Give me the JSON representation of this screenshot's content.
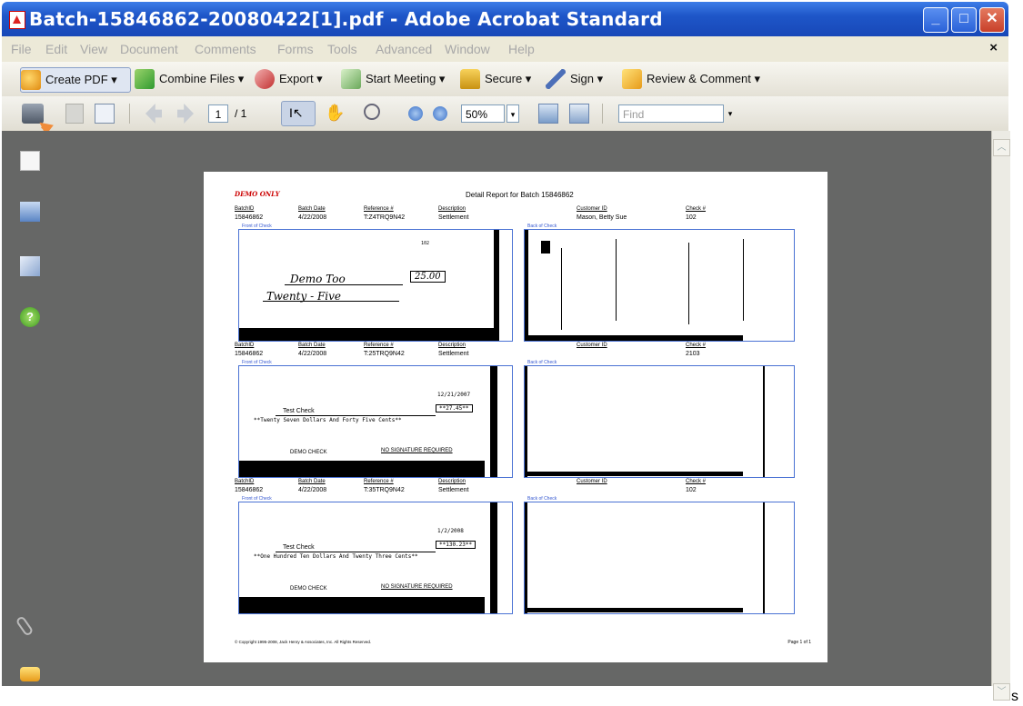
{
  "window": {
    "title": "Batch-15846862-20080422[1].pdf - Adobe Acrobat Standard",
    "minimize": "_",
    "maximize": "□",
    "close": "✕"
  },
  "menu": [
    "File",
    "Edit",
    "View",
    "Document",
    "Comments",
    "Forms",
    "Tools",
    "Advanced",
    "Window",
    "Help"
  ],
  "menu_close": "×",
  "toolbar": {
    "create_pdf": "Create PDF ▾",
    "combine": "Combine Files ▾",
    "export": "Export ▾",
    "meeting": "Start Meeting ▾",
    "secure": "Secure ▾",
    "sign": "Sign ▾",
    "review": "Review & Comment ▾"
  },
  "nav": {
    "page": "1",
    "of": "/ 1",
    "zoom": "50%",
    "find_placeholder": "Find"
  },
  "colors": {
    "titlebar": "#1e56c8",
    "accent_arrow": "#f08c3a",
    "workspace": "#666766"
  },
  "report": {
    "demo": "DEMO ONLY",
    "title": "Detail Report for Batch 15846862",
    "headers": [
      "BatchID",
      "Batch Date",
      "Reference #",
      "Description",
      "Customer ID",
      "Check #"
    ],
    "rows": [
      {
        "batch": "15846862",
        "date": "4/22/2008",
        "ref": "T:Z4TRQ9N42",
        "desc": "Settlement",
        "cust": "Mason, Betty Sue",
        "check": "102"
      },
      {
        "batch": "15846862",
        "date": "4/22/2008",
        "ref": "T:25TRQ9N42",
        "desc": "Settlement",
        "cust": "",
        "check": "2103"
      },
      {
        "batch": "15846862",
        "date": "4/22/2008",
        "ref": "T:35TRQ9N42",
        "desc": "Settlement",
        "cust": "",
        "check": "102"
      }
    ],
    "front_label": "Front of Check",
    "back_label": "Back of Check",
    "check1": {
      "payee": "Demo Too",
      "amount": "25.00",
      "words": "Twenty - Five",
      "num": "102"
    },
    "check2": {
      "date": "12/21/2007",
      "payee": "Test Check",
      "amount": "**27.45**",
      "words": "**Twenty Seven Dollars And Forty Five Cents**",
      "memo": "DEMO CHECK",
      "sig": "NO SIGNATURE REQUIRED"
    },
    "check3": {
      "date": "1/2/2008",
      "payee": "Test Check",
      "amount": "**130.23**",
      "words": "**One Hundred Ten Dollars And Twenty Three Cents**",
      "memo": "DEMO CHECK",
      "sig": "NO SIGNATURE REQUIRED"
    },
    "copyright": "© Copyright 1995-2008, Jack Henry & Associates, Inc. All Rights Reserved.",
    "page_of": "Page 1 of 1"
  },
  "stray_char": "s"
}
